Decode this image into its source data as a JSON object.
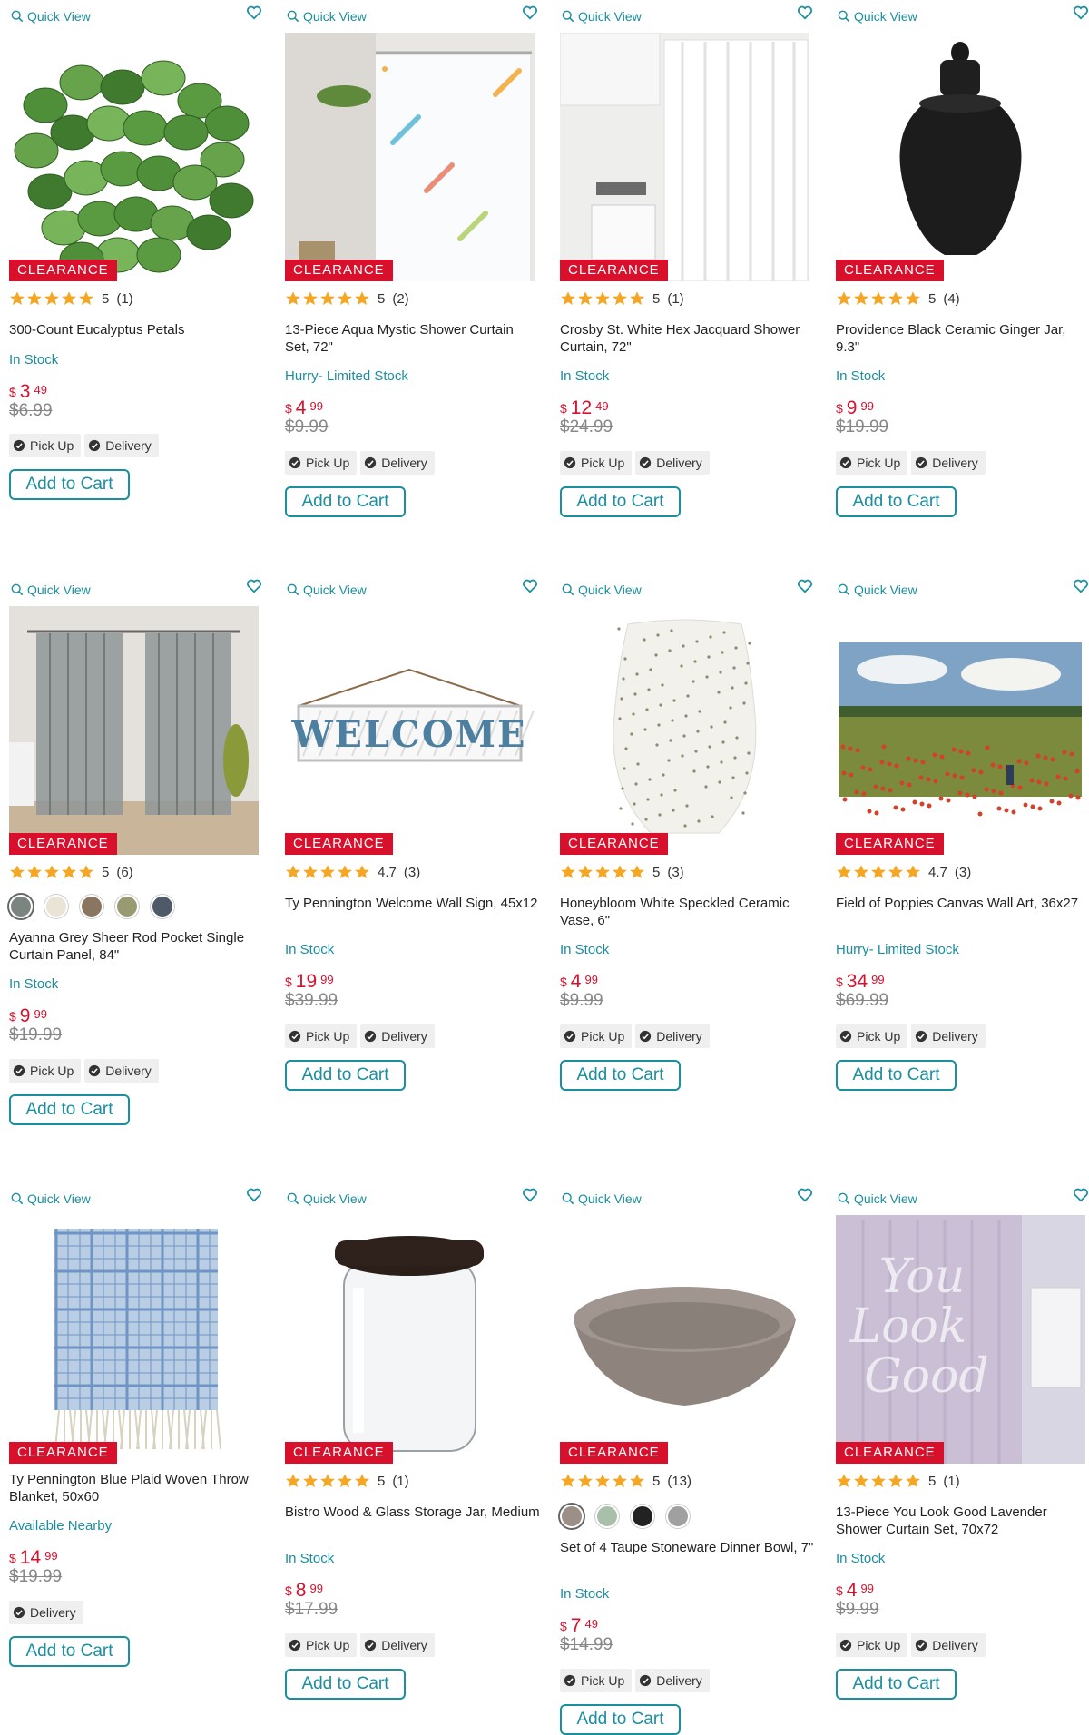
{
  "labels": {
    "quick_view": "Quick View",
    "clearance": "CLEARANCE",
    "pick_up": "Pick Up",
    "delivery": "Delivery",
    "add_to_cart": "Add to Cart",
    "currency": "$"
  },
  "colors": {
    "accent": "#1b8ea0",
    "badge": "#d8102c",
    "price": "#d8102c",
    "star": "#f5a623"
  },
  "products": [
    {
      "title": "300-Count Eucalyptus Petals",
      "rating": "5",
      "reviews": "(1)",
      "stars": 5,
      "stock": "In Stock",
      "price_dollars": "3",
      "price_cents": "49",
      "was": "$6.99",
      "fulfillment": [
        "pick_up",
        "delivery"
      ],
      "image": "eucalyptus-petals"
    },
    {
      "title": "13-Piece Aqua Mystic Shower Curtain Set, 72\"",
      "rating": "5",
      "reviews": "(2)",
      "stars": 5,
      "stock": "Hurry- Limited Stock",
      "price_dollars": "4",
      "price_cents": "99",
      "was": "$9.99",
      "fulfillment": [
        "pick_up",
        "delivery"
      ],
      "image": "aqua-shower-curtain"
    },
    {
      "title": "Crosby St. White Hex Jacquard Shower Curtain, 72\"",
      "rating": "5",
      "reviews": "(1)",
      "stars": 5,
      "stock": "In Stock",
      "price_dollars": "12",
      "price_cents": "49",
      "was": "$24.99",
      "fulfillment": [
        "pick_up",
        "delivery"
      ],
      "image": "white-shower-curtain"
    },
    {
      "title": "Providence Black Ceramic Ginger Jar, 9.3\"",
      "rating": "5",
      "reviews": "(4)",
      "stars": 5,
      "stock": "In Stock",
      "price_dollars": "9",
      "price_cents": "99",
      "was": "$19.99",
      "fulfillment": [
        "pick_up",
        "delivery"
      ],
      "image": "black-ginger-jar"
    },
    {
      "title": "Ayanna Grey Sheer Rod Pocket Single Curtain Panel, 84\"",
      "rating": "5",
      "reviews": "(6)",
      "stars": 5,
      "stock": "In Stock",
      "price_dollars": "9",
      "price_cents": "99",
      "was": "$19.99",
      "fulfillment": [
        "pick_up",
        "delivery"
      ],
      "image": "grey-sheer-curtain",
      "swatches": [
        "#7a8580",
        "#e9e4d6",
        "#8a7660",
        "#9a9a72",
        "#4e5a68"
      ]
    },
    {
      "title": "Ty Pennington Welcome Wall Sign, 45x12",
      "rating": "4.7",
      "reviews": "(3)",
      "stars": 5,
      "stock": "In Stock",
      "price_dollars": "19",
      "price_cents": "99",
      "was": "$39.99",
      "fulfillment": [
        "pick_up",
        "delivery"
      ],
      "image": "welcome-sign"
    },
    {
      "title": "Honeybloom White Speckled Ceramic Vase, 6\"",
      "rating": "5",
      "reviews": "(3)",
      "stars": 5,
      "stock": "In Stock",
      "price_dollars": "4",
      "price_cents": "99",
      "was": "$9.99",
      "fulfillment": [
        "pick_up",
        "delivery"
      ],
      "image": "speckled-vase"
    },
    {
      "title": "Field of Poppies Canvas Wall Art, 36x27",
      "rating": "4.7",
      "reviews": "(3)",
      "stars": 5,
      "stock": "Hurry- Limited Stock",
      "price_dollars": "34",
      "price_cents": "99",
      "was": "$69.99",
      "fulfillment": [
        "pick_up",
        "delivery"
      ],
      "image": "poppies-canvas"
    },
    {
      "title": "Ty Pennington Blue Plaid Woven Throw Blanket, 50x60",
      "rating": "",
      "reviews": "",
      "stars": 0,
      "stock": "Available Nearby",
      "price_dollars": "14",
      "price_cents": "99",
      "was": "$19.99",
      "fulfillment": [
        "delivery"
      ],
      "image": "blue-plaid-blanket"
    },
    {
      "title": "Bistro Wood & Glass Storage Jar, Medium",
      "rating": "5",
      "reviews": "(1)",
      "stars": 5,
      "stock": "In Stock",
      "price_dollars": "8",
      "price_cents": "99",
      "was": "$17.99",
      "fulfillment": [
        "pick_up",
        "delivery"
      ],
      "image": "glass-storage-jar"
    },
    {
      "title": "Set of 4 Taupe Stoneware Dinner Bowl, 7\"",
      "rating": "5",
      "reviews": "(13)",
      "stars": 5,
      "stock": "In Stock",
      "price_dollars": "7",
      "price_cents": "49",
      "was": "$14.99",
      "fulfillment": [
        "pick_up",
        "delivery"
      ],
      "image": "taupe-bowl",
      "swatches": [
        "#9b8f87",
        "#a9bfaa",
        "#222222",
        "#a0a0a0"
      ]
    },
    {
      "title": "13-Piece You Look Good Lavender Shower Curtain Set, 70x72",
      "rating": "5",
      "reviews": "(1)",
      "stars": 5,
      "stock": "In Stock",
      "price_dollars": "4",
      "price_cents": "99",
      "was": "$9.99",
      "fulfillment": [
        "pick_up",
        "delivery"
      ],
      "image": "lavender-shower-curtain",
      "image_text": "You Look Good"
    }
  ]
}
